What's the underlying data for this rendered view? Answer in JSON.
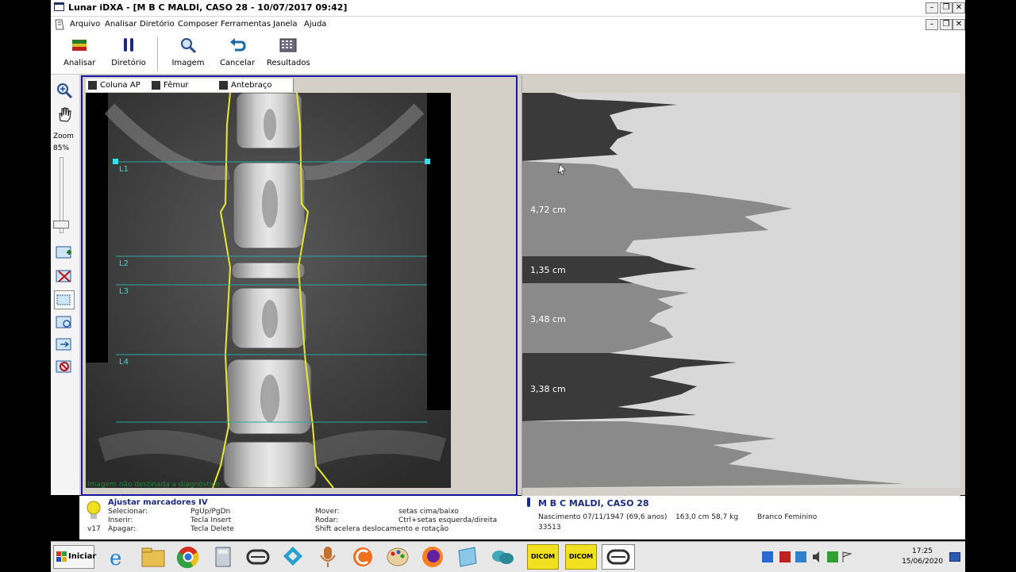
{
  "window": {
    "title": "Lunar iDXA - [M B C MALDI, CASO 28 - 10/07/2017 09:42]"
  },
  "menu": [
    "Arquivo",
    "Analisar",
    "Diretório",
    "Composer",
    "Ferramentas",
    "Janela",
    "Ajuda"
  ],
  "toolbar": {
    "analisar": "Analisar",
    "diretorio": "Diretório",
    "imagem": "Imagem",
    "cancelar": "Cancelar",
    "resultados": "Resultados"
  },
  "left_tools": {
    "zoom_label": "Zoom",
    "zoom_value": "85%"
  },
  "tabs": [
    "Coluna AP",
    "Fêmur direito",
    "Antebraço Esq."
  ],
  "xray": {
    "vertebra_labels": [
      "L1",
      "L2",
      "L3",
      "L4"
    ],
    "footer_text": "Imagem não destinada a diagnóstico"
  },
  "profile": {
    "measurements": [
      "4,72 cm",
      "1,35 cm",
      "3,48 cm",
      "3,38 cm"
    ]
  },
  "status": {
    "heading": "Ajustar marcadores IV",
    "version": "v17",
    "rows": [
      {
        "label": "Selecionar:",
        "key": "PgUp/PgDn"
      },
      {
        "label": "Inserir:",
        "key": "Tecla Insert"
      },
      {
        "label": "Apagar:",
        "key": "Tecla Delete"
      }
    ],
    "move_rows": [
      {
        "label": "Mover:",
        "key": "setas cima/baixo"
      },
      {
        "label": "Rodar:",
        "key": "Ctrl+setas esquerda/direita"
      },
      {
        "label": "Shift acelera deslocamento e rotação",
        "key": ""
      }
    ],
    "patient_name": "M B C MALDI, CASO 28",
    "birth": "Nascimento 07/11/1947  (69,6 anos)",
    "height_weight": "163,0 cm  58,7 kg",
    "ethnicity": "Branco Feminino",
    "patient_id": "33513"
  },
  "taskbar": {
    "start_label": "Iniciar",
    "dicom_label": "DICOM",
    "time": "17:25",
    "date": "15/06/2020"
  }
}
